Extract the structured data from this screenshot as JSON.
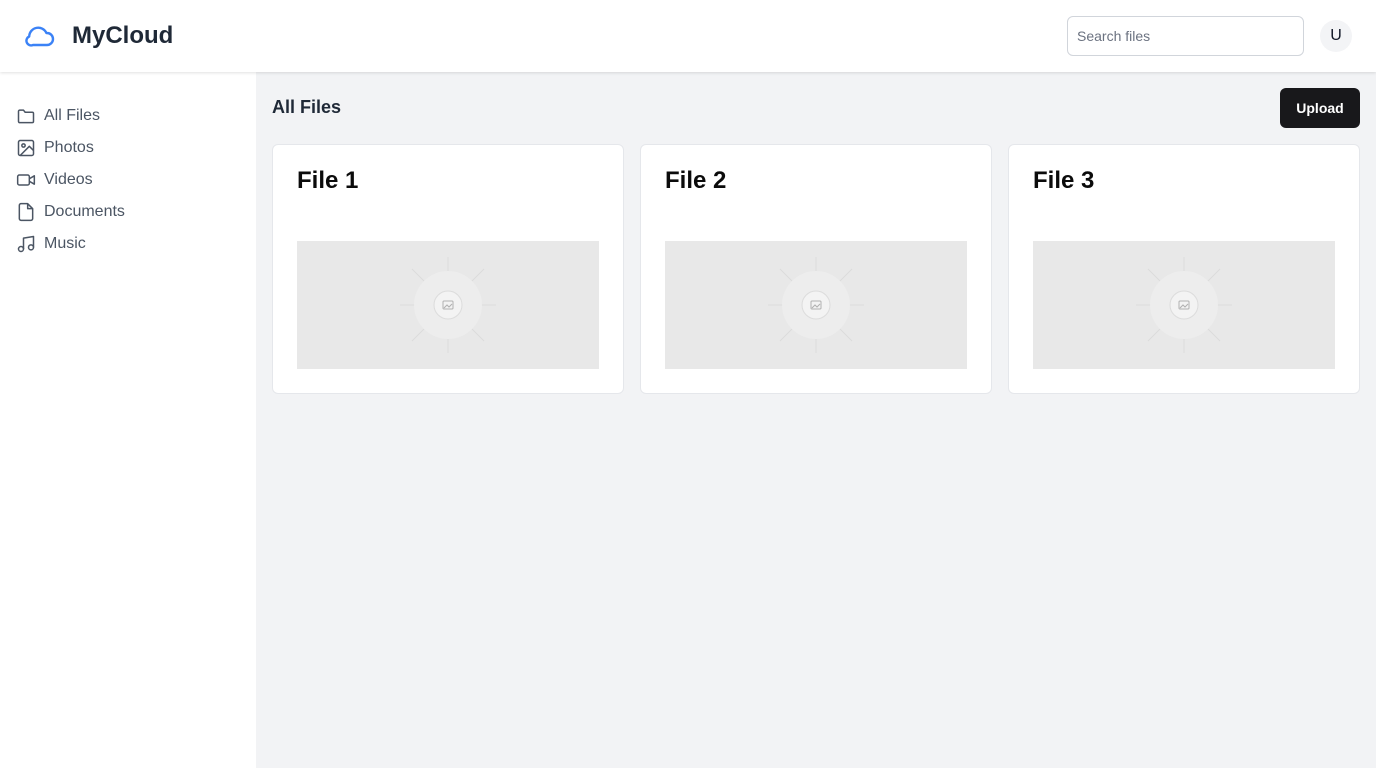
{
  "app": {
    "name": "MyCloud",
    "logo_icon": "cloud-icon",
    "accent_color": "#3b82f6"
  },
  "header": {
    "search_placeholder": "Search files",
    "avatar_initial": "U"
  },
  "sidebar": {
    "items": [
      {
        "label": "All Files",
        "icon": "folder-icon"
      },
      {
        "label": "Photos",
        "icon": "image-icon"
      },
      {
        "label": "Videos",
        "icon": "video-icon"
      },
      {
        "label": "Documents",
        "icon": "document-icon"
      },
      {
        "label": "Music",
        "icon": "music-icon"
      }
    ]
  },
  "main": {
    "title": "All Files",
    "upload_label": "Upload",
    "files": [
      {
        "name": "File 1",
        "thumbnail_icon": "image-placeholder-icon"
      },
      {
        "name": "File 2",
        "thumbnail_icon": "image-placeholder-icon"
      },
      {
        "name": "File 3",
        "thumbnail_icon": "image-placeholder-icon"
      }
    ]
  }
}
